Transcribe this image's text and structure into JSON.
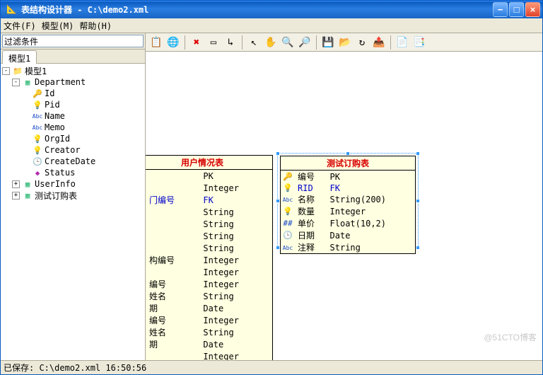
{
  "window": {
    "title": "表结构设计器 - C:\\demo2.xml"
  },
  "menu": {
    "file": "文件(F)",
    "model": "模型(M)",
    "help": "帮助(H)"
  },
  "filter": {
    "label": "过滤条件"
  },
  "tabs": {
    "model1": "模型1"
  },
  "tree": {
    "root": "模型1",
    "dept": "Department",
    "fields": [
      {
        "icon": "key-icon",
        "glyph": "🔑",
        "color": "#d4a000",
        "name": "Id"
      },
      {
        "icon": "bulb-icon",
        "glyph": "💡",
        "color": "#c0a000",
        "name": "Pid"
      },
      {
        "icon": "abc-icon",
        "glyph": "Abc",
        "color": "#1548c8",
        "name": "Name"
      },
      {
        "icon": "abc-icon",
        "glyph": "Abc",
        "color": "#1548c8",
        "name": "Memo"
      },
      {
        "icon": "bulb-icon",
        "glyph": "💡",
        "color": "#c0a000",
        "name": "OrgId"
      },
      {
        "icon": "bulb-icon",
        "glyph": "💡",
        "color": "#c0a000",
        "name": "Creator"
      },
      {
        "icon": "clock-icon",
        "glyph": "🕒",
        "color": "#c00000",
        "name": "CreateDate"
      },
      {
        "icon": "diamond-icon",
        "glyph": "◆",
        "color": "#b030b0",
        "name": "Status"
      }
    ],
    "userinfo": "UserInfo",
    "order": "测试订购表"
  },
  "toolbarIcons": [
    "copy-icon",
    "globe-icon",
    "sep",
    "delete-red-icon",
    "window-icon",
    "connector-icon",
    "sep",
    "pointer-icon",
    "hand-icon",
    "zoom-in-icon",
    "zoom-out-icon",
    "sep",
    "disk-icon",
    "open-icon",
    "refresh-icon",
    "export-icon",
    "sep",
    "script-icon",
    "properties-icon"
  ],
  "toolbarGlyphs": {
    "copy-icon": "📋",
    "globe-icon": "🌐",
    "delete-red-icon": "✖",
    "window-icon": "▭",
    "connector-icon": "↳",
    "pointer-icon": "↖",
    "hand-icon": "✋",
    "zoom-in-icon": "🔍",
    "zoom-out-icon": "🔎",
    "disk-icon": "💾",
    "open-icon": "📂",
    "refresh-icon": "↻",
    "export-icon": "📤",
    "script-icon": "📄",
    "properties-icon": "📑"
  },
  "entities": {
    "user": {
      "title": "用户情况表",
      "rows": [
        {
          "ico": "",
          "name": "",
          "type": "PK"
        },
        {
          "ico": "",
          "name": "",
          "type": "Integer"
        },
        {
          "ico": "",
          "name": "门编号",
          "type": "FK",
          "blue": true
        },
        {
          "ico": "",
          "name": "",
          "type": "String"
        },
        {
          "ico": "",
          "name": "",
          "type": "String"
        },
        {
          "ico": "",
          "name": "",
          "type": "String"
        },
        {
          "ico": "",
          "name": "",
          "type": "String"
        },
        {
          "ico": "",
          "name": "构编号",
          "type": "Integer"
        },
        {
          "ico": "",
          "name": "",
          "type": "Integer"
        },
        {
          "ico": "",
          "name": "编号",
          "type": "Integer"
        },
        {
          "ico": "",
          "name": "姓名",
          "type": "String"
        },
        {
          "ico": "",
          "name": "期",
          "type": "Date"
        },
        {
          "ico": "",
          "name": "编号",
          "type": "Integer"
        },
        {
          "ico": "",
          "name": "姓名",
          "type": "String"
        },
        {
          "ico": "",
          "name": "期",
          "type": "Date"
        },
        {
          "ico": "",
          "name": "",
          "type": "Integer"
        }
      ]
    },
    "order": {
      "title": "测试订购表",
      "rows": [
        {
          "ico": "🔑",
          "name": "编号",
          "type": "PK"
        },
        {
          "ico": "💡",
          "name": "RID",
          "type": "FK",
          "blue": true
        },
        {
          "ico": "Abc",
          "icoColor": "#1548c8",
          "icoSize": "8px",
          "name": "名称",
          "type": "String(200)"
        },
        {
          "ico": "💡",
          "name": "数量",
          "type": "Integer"
        },
        {
          "ico": "##",
          "icoColor": "#1548c8",
          "name": "单价",
          "type": "Float(10,2)"
        },
        {
          "ico": "🕒",
          "name": "日期",
          "type": "Date"
        },
        {
          "ico": "Abc",
          "icoColor": "#1548c8",
          "icoSize": "8px",
          "name": "注释",
          "type": "String"
        }
      ]
    }
  },
  "status": "已保存: C:\\demo2.xml 16:50:56",
  "watermark": "@51CTO博客"
}
